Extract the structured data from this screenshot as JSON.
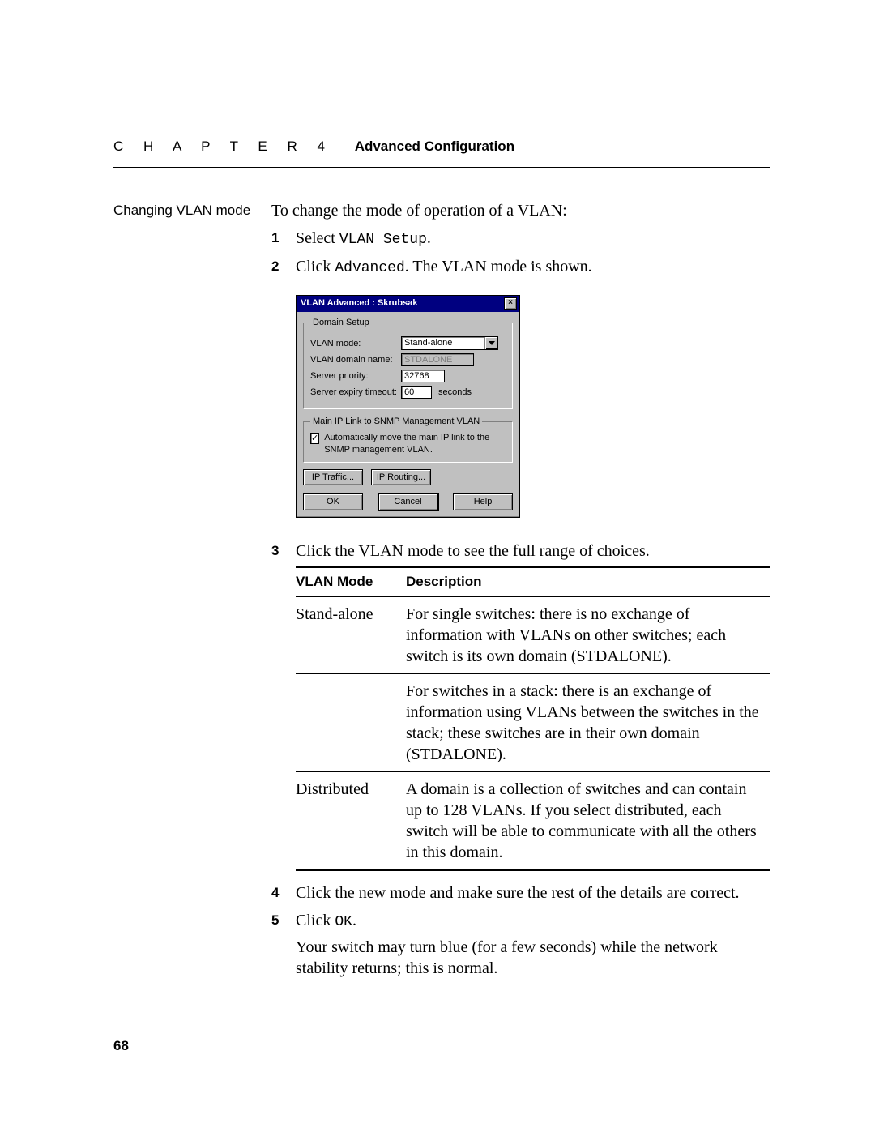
{
  "header": {
    "chapter_label": "C H A P T E R 4",
    "chapter_title": "Advanced Configuration"
  },
  "sidehead": "Changing VLAN mode",
  "intro": "To change the mode of operation of a VLAN:",
  "steps": {
    "s1_prefix": "Select ",
    "s1_mono": "VLAN Setup",
    "s1_suffix": ".",
    "s2_prefix": "Click ",
    "s2_mono": "Advanced",
    "s2_suffix": ". The VLAN mode is shown.",
    "s3": "Click the VLAN mode to see the full range of choices.",
    "s4": "Click the new mode and make sure the rest of the details are correct.",
    "s5_prefix": "Click ",
    "s5_mono": "OK",
    "s5_suffix": ".",
    "s5_note": "Your switch may turn blue (for a few seconds) while the network stability returns; this is normal."
  },
  "step_numbers": {
    "n1": "1",
    "n2": "2",
    "n3": "3",
    "n4": "4",
    "n5": "5"
  },
  "dialog": {
    "title": "VLAN Advanced : Skrubsak",
    "group_domain": "Domain Setup",
    "lbl_mode": "VLAN mode:",
    "val_mode": "Stand-alone",
    "lbl_domain": "VLAN domain name:",
    "val_domain": "STDALONE",
    "lbl_priority": "Server priority:",
    "val_priority": "32768",
    "lbl_timeout": "Server expiry timeout:",
    "val_timeout": "60",
    "unit_seconds": "seconds",
    "group_iplink": "Main IP Link to SNMP Management VLAN",
    "chk_label": "Automatically move the main IP link to the SNMP management VLAN.",
    "chk_mark": "✓",
    "btn_iptraffic_pre": "I",
    "btn_iptraffic_u": "P",
    "btn_iptraffic_post": " Traffic...",
    "btn_iprouting_pre": "IP ",
    "btn_iprouting_u": "R",
    "btn_iprouting_post": "outing...",
    "btn_ok": "OK",
    "btn_cancel": "Cancel",
    "btn_help": "Help",
    "close_x": "×"
  },
  "table": {
    "hdr_mode": "VLAN Mode",
    "hdr_desc": "Description",
    "rows": [
      {
        "name": "Stand-alone",
        "desc": "For single switches: there is no exchange of information with VLANs on other switches; each switch is its own domain (STDALONE)."
      },
      {
        "name": "",
        "desc": "For switches in a stack: there is an exchange of information using VLANs between the switches in the stack; these switches are in their own domain (STDALONE)."
      },
      {
        "name": "Distributed",
        "desc": "A domain is a collection of switches and can contain up to 128 VLANs. If you select distributed, each switch will be able to communicate with all the others in this domain."
      }
    ]
  },
  "page_number": "68"
}
